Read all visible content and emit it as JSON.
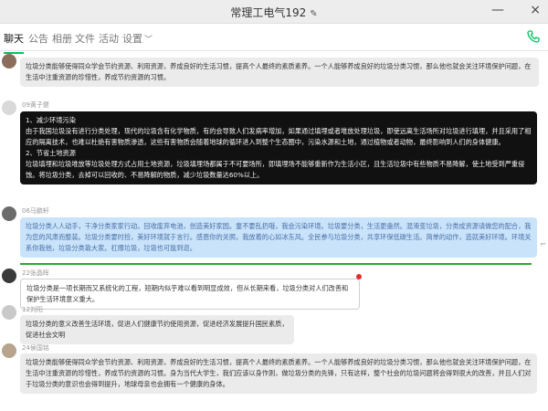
{
  "window": {
    "title": "常理工电气192",
    "edit_icon": "pencil-icon",
    "minimize_glyph": "—",
    "close_glyph": "×"
  },
  "tabs": [
    {
      "label": "聊天",
      "active": true
    },
    {
      "label": "公告"
    },
    {
      "label": "相册"
    },
    {
      "label": "文件"
    },
    {
      "label": "活动"
    },
    {
      "label": "设置",
      "has_dropdown": true
    }
  ],
  "call_icon": "phone-icon",
  "messages": [
    {
      "sender": "",
      "style": "gray",
      "paragraphs": [
        "垃圾分类能够使得同众学会节约资源、利用资源，养成良好的生活习惯，提高个人最终的素质素养。一个人能够养成良好的垃圾分类习惯，那么他也就会关注环境保护问题，在生活中注重资源的珍惜性，养成节约资源的习惯。"
      ]
    },
    {
      "sender": "09黄子健",
      "style": "dark",
      "paragraphs": [
        "1、减少环境污染",
        "由于我国垃圾没有进行分类处理，现代的垃圾含有化学物质，有的会导致人们发病率增加，如果通过填埋或者堆放处理垃圾，即使远离生活场所对垃圾进行填埋，并且采用了相应的隔离技术，也难以杜绝有害物质渗透，这些有害物质会随着地球的循环进入到整个生态圈中，污染水源和土地，通过植物或者动物，最终影响到人们的身体健康。",
        "2、节省土地资源",
        "垃圾填埋和垃圾堆放等垃圾处理方式占用土地资源，垃圾填埋场都属于不可要场所，即填埋场不能够重新作为生活小区，且生活垃圾中有些物质不易降解，使土地受到严重侵蚀。将垃圾分类，去掉可以回收的、不易降解的物质，减少垃圾数量达60%以上。"
      ]
    },
    {
      "sender": "06马鹏轩",
      "style": "blue",
      "paragraphs": [
        "垃圾分类人人动手，干净分类家家行动。回收废弃电池，创造美好家园。童不要乱扔哦，我会污染环境。垃圾要分类，生活更盎然。混淆变垃圾，分类成资源请做您的配合，我为您的风肃而整装。垃圾分类要时捡，美好环境就于言行。感恩你的关照，我放着的心如冰东风。全民参与垃圾分类，共享环保低碳生活。简单的动作，造就美好环境。环境关系你我他，垃圾分类靠大家。杠爆垃圾，垃圾也可能到迩。"
      ]
    },
    {
      "sender": "22张晶晖",
      "style": "outlined",
      "paragraphs": [
        "垃圾分类是一项长期而又系统化的工程，短期内似乎难以看到明显成效，但从长期来看，垃圾分类对人们改善和保护生活环境意义重大。"
      ]
    },
    {
      "sender": "12刘阳",
      "style": "gray",
      "paragraphs": [
        "垃圾分类的意义改善生活环境，促进人们健康节约使用资源，促进经济发展提升国民素质，促进社会文明"
      ]
    },
    {
      "sender": "24侯国铭",
      "style": "gray",
      "paragraphs": [
        "垃圾分类能够使得同众学会节约资源、利用资源，养成良好的生活习惯，提高个人最终的素质素养。一个人能够养成良好的垃圾分类习惯，那么他也就会关注环境保护问题，在生活中注重资源的珍惜性，养成节约资源的习惯。身为当代大学生，我们应该以身作则，做垃圾分类的先锋，只有这样，整个社会的垃圾问题将会得到很大的改善，并且人们对于垃圾分类的意识也会得到提升，地球母亲也会拥有一个健康的身体。"
      ]
    }
  ],
  "colors": {
    "accent": "#07c160",
    "bubble_gray": "#ebebeb",
    "bubble_dark": "#111111",
    "bubble_blue": "#c9e3fb"
  }
}
